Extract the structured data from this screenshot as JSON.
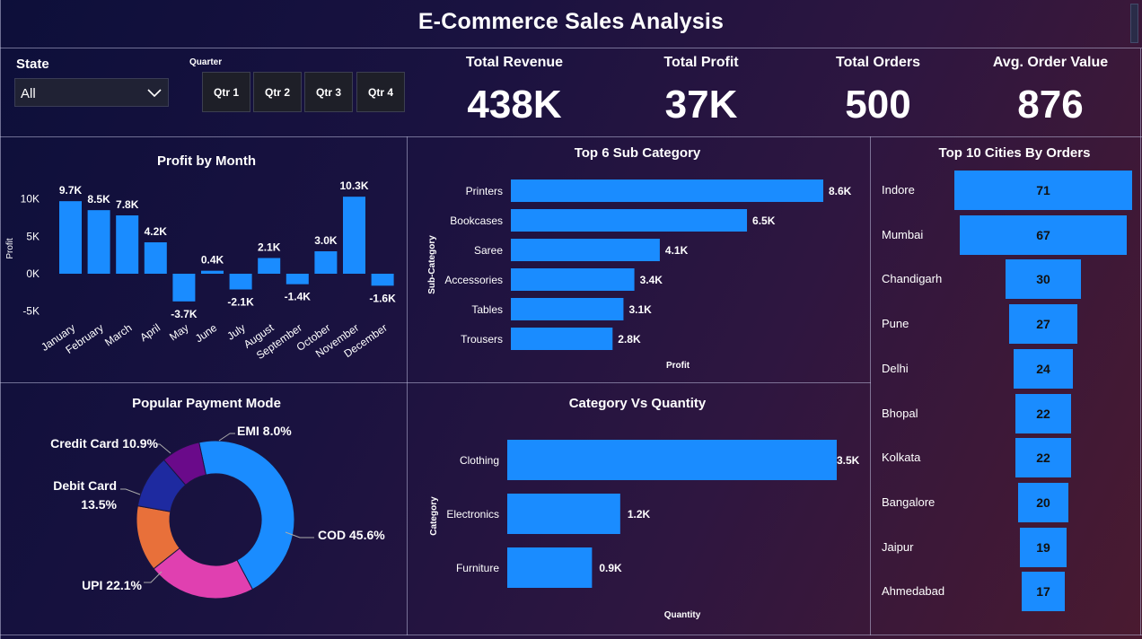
{
  "header": {
    "title": "E-Commerce Sales Analysis"
  },
  "filters": {
    "state_label": "State",
    "state_value": "All",
    "quarter_label": "Quarter",
    "quarters": [
      "Qtr 1",
      "Qtr 2",
      "Qtr 3",
      "Qtr 4"
    ]
  },
  "kpis": [
    {
      "label": "Total Revenue",
      "value": "438K"
    },
    {
      "label": "Total Profit",
      "value": "37K"
    },
    {
      "label": "Total Orders",
      "value": "500"
    },
    {
      "label": "Avg. Order Value",
      "value": "876"
    }
  ],
  "colors": {
    "bar": "#1a8cff",
    "border": "#bebedc"
  },
  "chart_data": [
    {
      "type": "bar",
      "title": "Profit by Month",
      "ylabel": "Profit",
      "xlabel": "",
      "categories": [
        "January",
        "February",
        "March",
        "April",
        "May",
        "June",
        "July",
        "August",
        "September",
        "October",
        "November",
        "December"
      ],
      "values": [
        9.7,
        8.5,
        7.8,
        4.2,
        -3.7,
        0.4,
        -2.1,
        2.1,
        -1.4,
        3.0,
        10.3,
        -1.6
      ],
      "data_labels": [
        "9.7K",
        "8.5K",
        "7.8K",
        "4.2K",
        "-3.7K",
        "0.4K",
        "-2.1K",
        "2.1K",
        "-1.4K",
        "3.0K",
        "10.3K",
        "-1.6K"
      ],
      "yticks": [
        10,
        5,
        0,
        -5
      ],
      "ytick_labels": [
        "10K",
        "5K",
        "0K",
        "-5K"
      ],
      "ylim": [
        -6,
        12
      ],
      "grid": false
    },
    {
      "type": "bar",
      "orientation": "horizontal",
      "title": "Top 6 Sub Category",
      "ylabel": "Sub-Category",
      "xlabel": "Profit",
      "categories": [
        "Printers",
        "Bookcases",
        "Saree",
        "Accessories",
        "Tables",
        "Trousers"
      ],
      "values": [
        8.6,
        6.5,
        4.1,
        3.4,
        3.1,
        2.8
      ],
      "data_labels": [
        "8.6K",
        "6.5K",
        "4.1K",
        "3.4K",
        "3.1K",
        "2.8K"
      ]
    },
    {
      "type": "bar",
      "orientation": "horizontal",
      "title": "Top 10 Cities By Orders",
      "categories": [
        "Indore",
        "Mumbai",
        "Chandigarh",
        "Pune",
        "Delhi",
        "Bhopal",
        "Kolkata",
        "Bangalore",
        "Jaipur",
        "Ahmedabad"
      ],
      "values": [
        71,
        67,
        30,
        27,
        24,
        22,
        22,
        20,
        19,
        17
      ],
      "data_labels": [
        "71",
        "67",
        "30",
        "27",
        "24",
        "22",
        "22",
        "20",
        "19",
        "17"
      ]
    },
    {
      "type": "pie",
      "title": "Popular Payment Mode",
      "categories": [
        "COD",
        "UPI",
        "Debit Card",
        "Credit Card",
        "EMI"
      ],
      "values": [
        45.6,
        22.1,
        13.5,
        10.9,
        8.0
      ],
      "data_labels": [
        "COD 45.6%",
        "UPI 22.1%",
        "Debit Card",
        "13.5%",
        "Credit Card 10.9%",
        "EMI 8.0%"
      ],
      "colors": [
        "#1a8cff",
        "#e040b0",
        "#e8703a",
        "#1e2aa0",
        "#6a0a8a"
      ]
    },
    {
      "type": "bar",
      "orientation": "horizontal",
      "title": "Category Vs Quantity",
      "ylabel": "Category",
      "xlabel": "Quantity",
      "categories": [
        "Clothing",
        "Electronics",
        "Furniture"
      ],
      "values": [
        3.5,
        1.2,
        0.9
      ],
      "data_labels": [
        "3.5K",
        "1.2K",
        "0.9K"
      ]
    }
  ]
}
